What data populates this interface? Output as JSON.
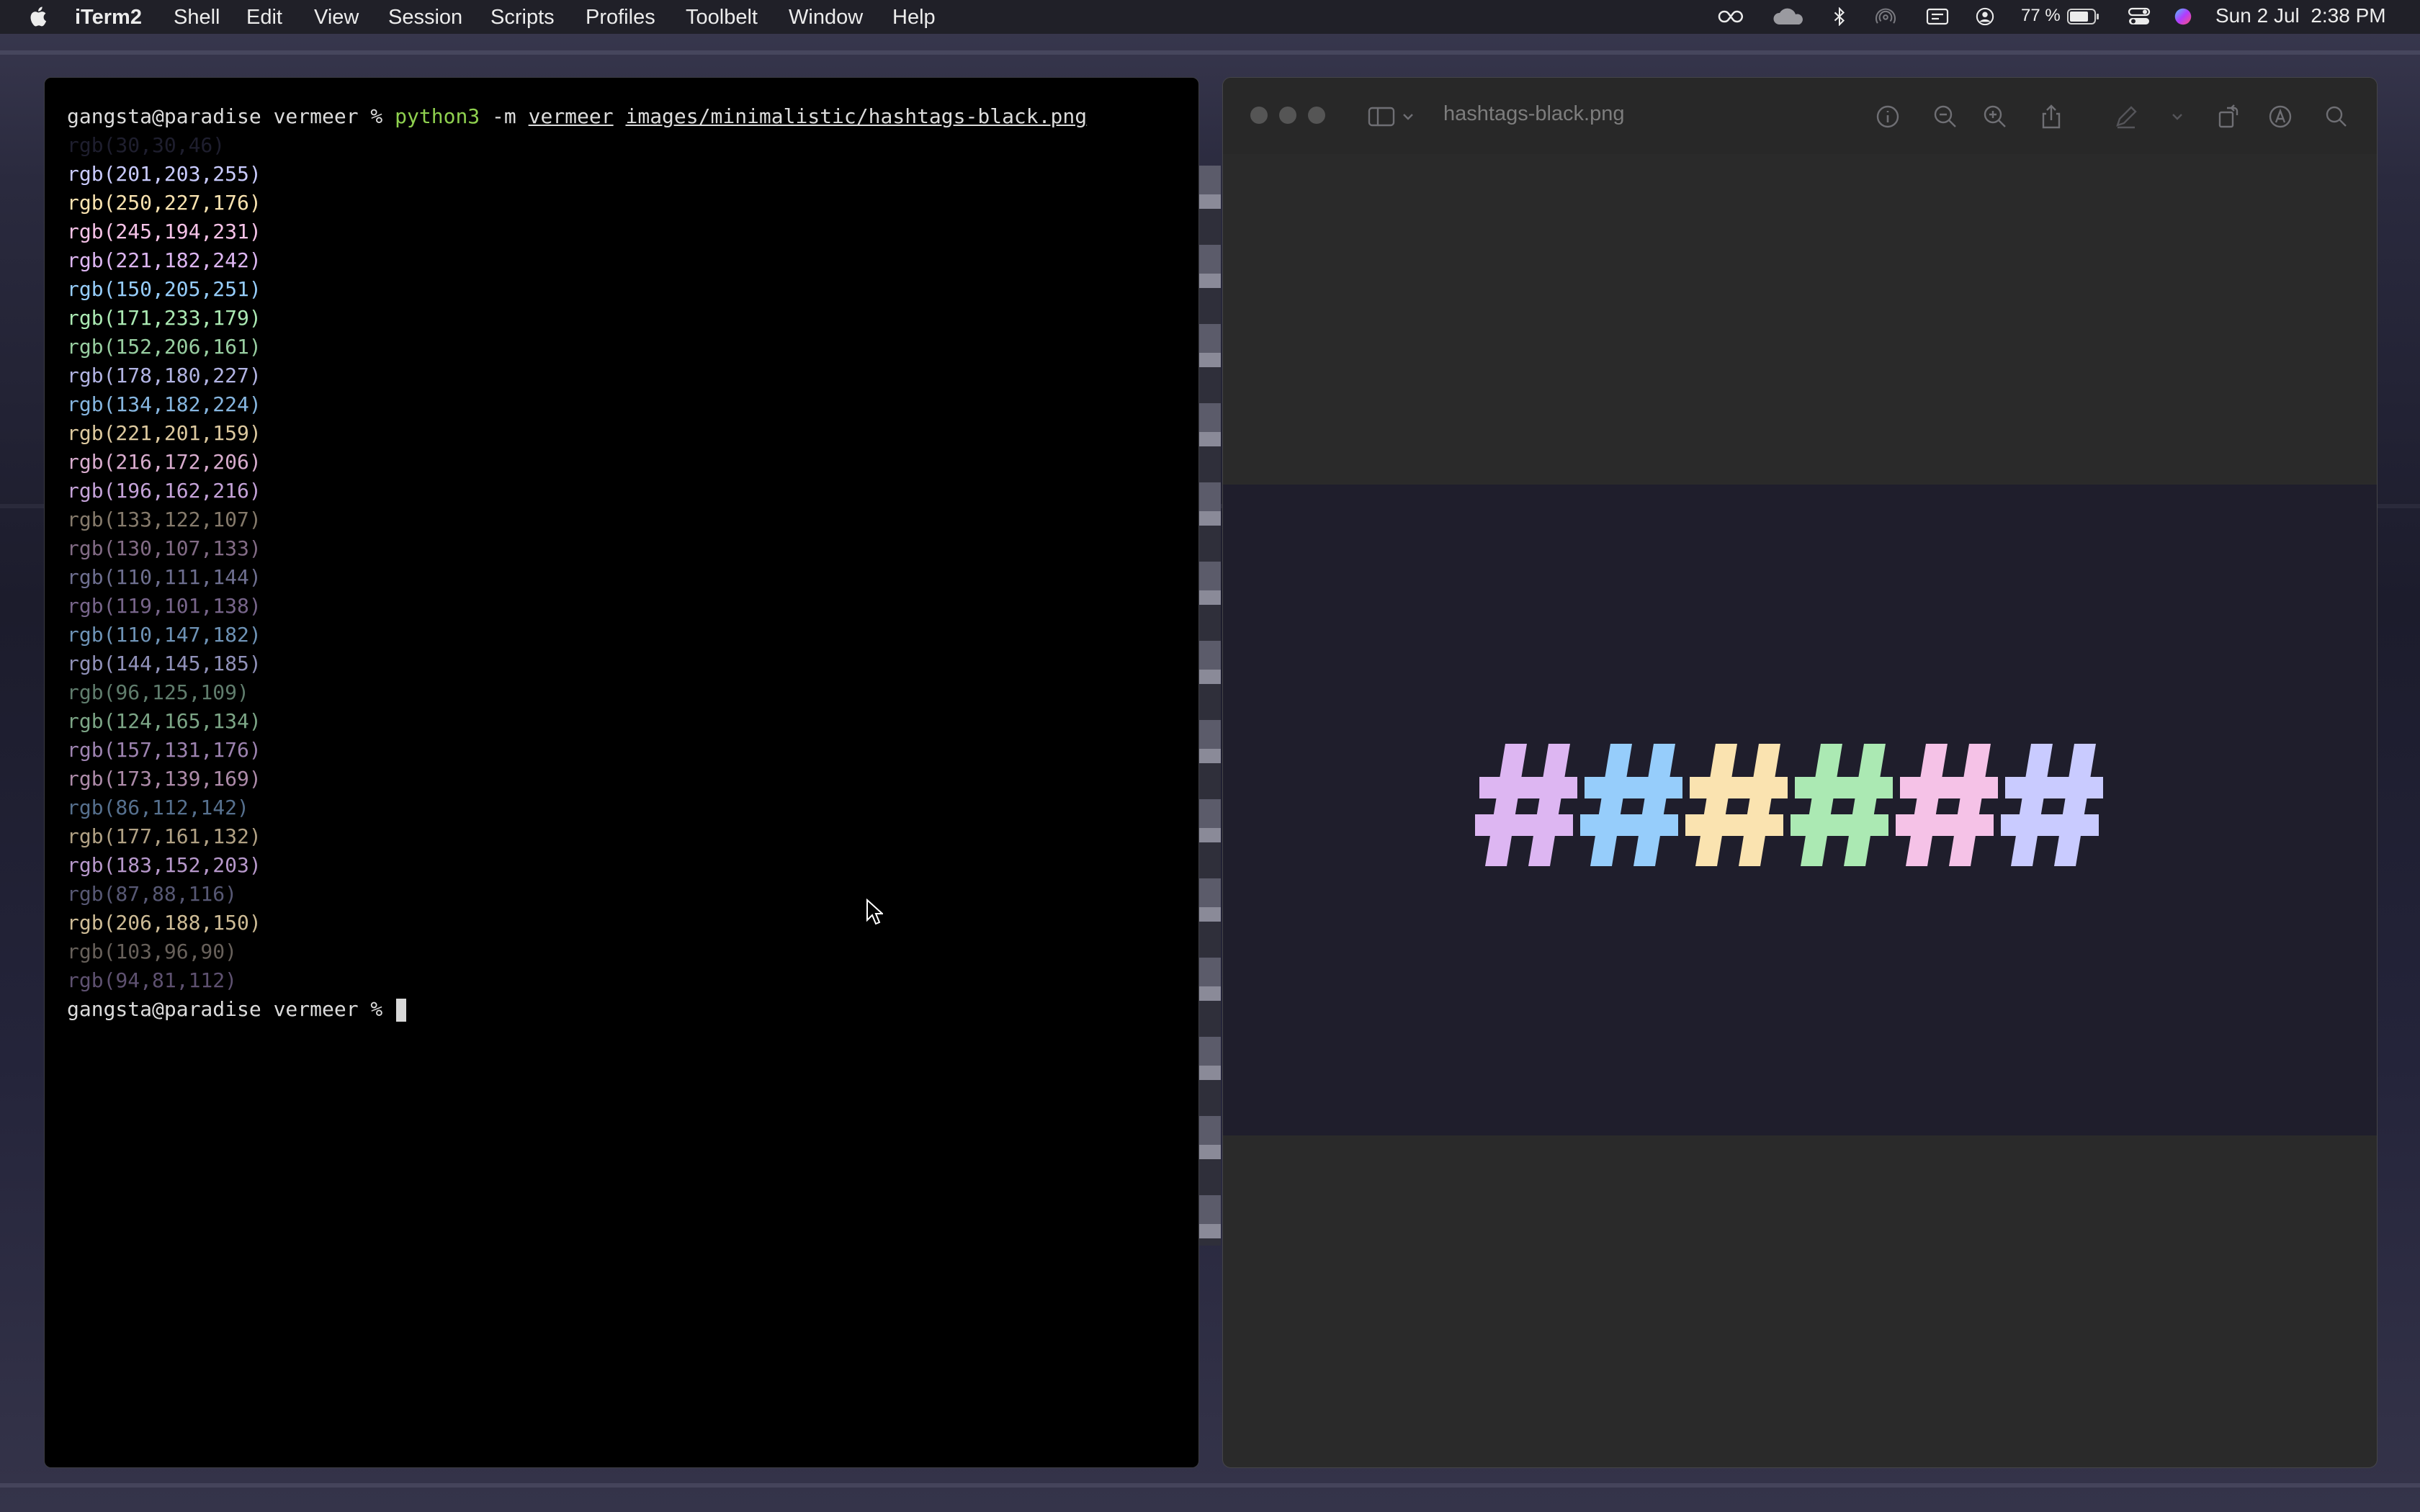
{
  "menubar": {
    "app_name": "iTerm2",
    "menus": [
      "Shell",
      "Edit",
      "View",
      "Session",
      "Scripts",
      "Profiles",
      "Toolbelt",
      "Window",
      "Help"
    ],
    "battery_percent": "77 %",
    "date": "Sun 2 Jul",
    "time": "2:38 PM",
    "status_icons": [
      "creative-cloud-icon",
      "cloud-icon",
      "bluetooth-icon",
      "airdrop-icon",
      "input-menu-icon",
      "user-icon",
      "battery-icon",
      "control-center-icon",
      "siri-icon"
    ]
  },
  "terminal": {
    "prompt": "gangsta@paradise vermeer % ",
    "command": {
      "program": "python3",
      "flag": "-m",
      "module": "vermeer",
      "path": "images/minimalistic/hashtags-black.png"
    },
    "output": [
      {
        "text": "rgb(30,30,46)",
        "color": "#1e1e2e"
      },
      {
        "text": "rgb(201,203,255)",
        "color": "#c9cbff"
      },
      {
        "text": "rgb(250,227,176)",
        "color": "#fae3b0"
      },
      {
        "text": "rgb(245,194,231)",
        "color": "#f5c2e7"
      },
      {
        "text": "rgb(221,182,242)",
        "color": "#ddb6f2"
      },
      {
        "text": "rgb(150,205,251)",
        "color": "#96cdfb"
      },
      {
        "text": "rgb(171,233,179)",
        "color": "#abe9b3"
      },
      {
        "text": "rgb(152,206,161)",
        "color": "#98cea1"
      },
      {
        "text": "rgb(178,180,227)",
        "color": "#b2b4e3"
      },
      {
        "text": "rgb(134,182,224)",
        "color": "#86b6e0"
      },
      {
        "text": "rgb(221,201,159)",
        "color": "#ddc99f"
      },
      {
        "text": "rgb(216,172,206)",
        "color": "#d8acce"
      },
      {
        "text": "rgb(196,162,216)",
        "color": "#c4a2d8"
      },
      {
        "text": "rgb(133,122,107)",
        "color": "#857a6b"
      },
      {
        "text": "rgb(130,107,133)",
        "color": "#826b85"
      },
      {
        "text": "rgb(110,111,144)",
        "color": "#6e6f90"
      },
      {
        "text": "rgb(119,101,138)",
        "color": "#77658a"
      },
      {
        "text": "rgb(110,147,182)",
        "color": "#6e93b6"
      },
      {
        "text": "rgb(144,145,185)",
        "color": "#9091b9"
      },
      {
        "text": "rgb(96,125,109)",
        "color": "#607d6d"
      },
      {
        "text": "rgb(124,165,134)",
        "color": "#7ca586"
      },
      {
        "text": "rgb(157,131,176)",
        "color": "#9d83b0"
      },
      {
        "text": "rgb(173,139,169)",
        "color": "#ad8ba9"
      },
      {
        "text": "rgb(86,112,142)",
        "color": "#56708e"
      },
      {
        "text": "rgb(177,161,132)",
        "color": "#b1a184"
      },
      {
        "text": "rgb(183,152,203)",
        "color": "#b798cb"
      },
      {
        "text": "rgb(87,88,116)",
        "color": "#575874"
      },
      {
        "text": "rgb(206,188,150)",
        "color": "#cebc96"
      },
      {
        "text": "rgb(103,96,90)",
        "color": "#67605a"
      },
      {
        "text": "rgb(94,81,112)",
        "color": "#5e5170"
      }
    ]
  },
  "preview": {
    "title": "hashtags-black.png",
    "toolbar_icons": [
      "sidebar-icon",
      "chevron-down-icon",
      "info-icon",
      "zoom-out-icon",
      "zoom-in-icon",
      "share-icon",
      "markup-icon",
      "chevron-down-icon",
      "rotate-icon",
      "annotate-icon",
      "search-icon"
    ],
    "image": {
      "background": "#1f1e2c",
      "hashtag_colors": [
        "#ddb6f2",
        "#96cdfb",
        "#fae3b0",
        "#abe9b3",
        "#f5c2e7",
        "#c9cbff"
      ]
    }
  }
}
